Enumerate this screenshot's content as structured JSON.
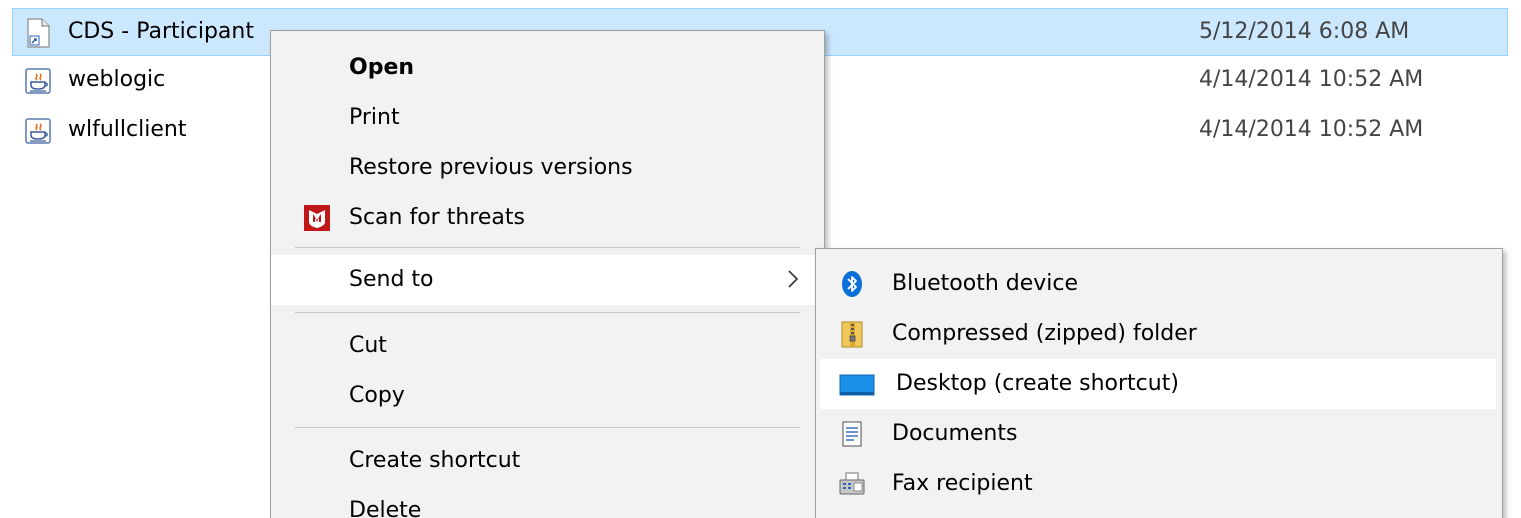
{
  "files": [
    {
      "name": "CDS - Participant",
      "date": "5/12/2014 6:08 AM",
      "icon": "shortcut-file-icon",
      "selected": true
    },
    {
      "name": "weblogic",
      "date": "4/14/2014 10:52 AM",
      "icon": "java-jar-icon",
      "selected": false
    },
    {
      "name": "wlfullclient",
      "date": "4/14/2014 10:52 AM",
      "icon": "java-jar-icon",
      "selected": false
    }
  ],
  "context_menu": {
    "items": {
      "open": "Open",
      "print": "Print",
      "restore": "Restore previous versions",
      "scan": "Scan for threats",
      "send_to": "Send to",
      "cut": "Cut",
      "copy": "Copy",
      "create_shortcut": "Create shortcut",
      "delete": "Delete"
    },
    "scan_icon": "mcafee-shield-icon",
    "send_to_arrow": "chevron-right-icon"
  },
  "send_to_menu": {
    "items": {
      "bluetooth": "Bluetooth device",
      "zip": "Compressed (zipped) folder",
      "desktop": "Desktop (create shortcut)",
      "documents": "Documents",
      "fax": "Fax recipient"
    },
    "icons": {
      "bluetooth": "bluetooth-icon",
      "zip": "zip-folder-icon",
      "desktop": "desktop-icon",
      "documents": "documents-icon",
      "fax": "fax-icon"
    }
  },
  "colors": {
    "selection_bg": "#cce8ff",
    "selection_border": "#99d1ff",
    "menu_bg": "#f2f2f2",
    "menu_highlight": "#ffffff",
    "mcafee_red": "#c01818",
    "bluetooth_blue": "#0a6fd6",
    "desktop_blue": "#1a8fe8"
  }
}
